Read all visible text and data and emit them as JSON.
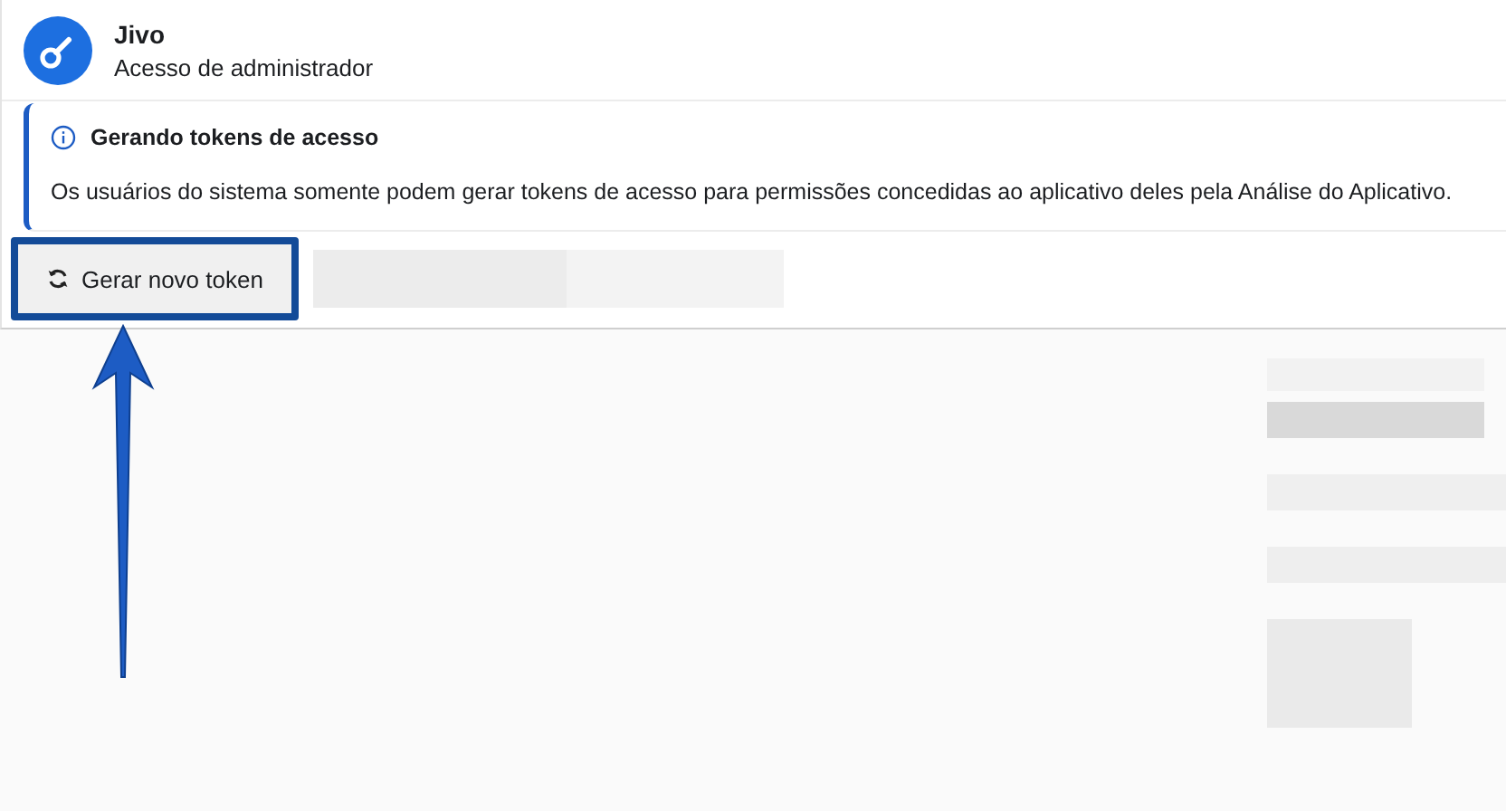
{
  "app": {
    "name": "Jivo",
    "role": "Acesso de administrador"
  },
  "notice": {
    "title": "Gerando tokens de acesso",
    "body": "Os usuários do sistema somente podem gerar tokens de acesso para permissões concedidas ao aplicativo deles pela Análise do Aplicativo."
  },
  "generate_button": {
    "label": "Gerar novo token",
    "highlighted": true
  }
}
